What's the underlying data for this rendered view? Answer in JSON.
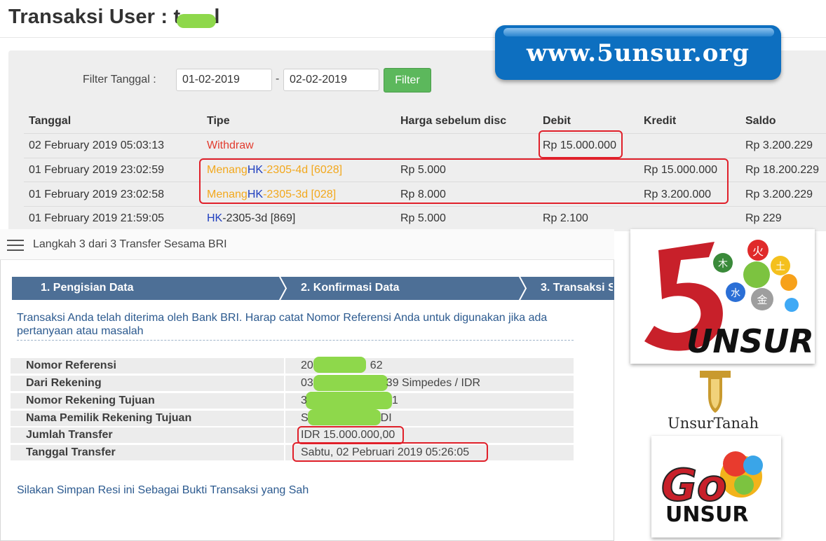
{
  "page": {
    "title": "Transaksi User : t",
    "title_tail": "l"
  },
  "filter": {
    "label": "Filter Tanggal :",
    "date_from": "01-02-2019",
    "separator": "-",
    "date_to": "02-02-2019",
    "button_label": "Filter"
  },
  "table": {
    "headers": [
      "Tanggal",
      "Tipe",
      "Harga sebelum disc",
      "Debit",
      "Kredit",
      "Saldo"
    ],
    "rows": [
      {
        "tanggal": "02 February 2019 05:03:13",
        "tipe_a": "Withdraw",
        "tipe_b": "",
        "tipe_c": "",
        "harga": "",
        "debit": "Rp 15.000.000",
        "kredit": "",
        "saldo": "Rp 3.200.229"
      },
      {
        "tanggal": "01 February 2019 23:02:59",
        "tipe_a": "Menang",
        "tipe_b": "HK",
        "tipe_c": "-2305-4d [6028]",
        "harga": "Rp 5.000",
        "debit": "",
        "kredit": "Rp 15.000.000",
        "saldo": "Rp 18.200.229"
      },
      {
        "tanggal": "01 February 2019 23:02:58",
        "tipe_a": "Menang",
        "tipe_b": "HK",
        "tipe_c": "-2305-3d [028]",
        "harga": "Rp 8.000",
        "debit": "",
        "kredit": "Rp 3.200.000",
        "saldo": "Rp 3.200.229"
      },
      {
        "tanggal": "01 February 2019 21:59:05",
        "tipe_a": "",
        "tipe_b": "HK",
        "tipe_c": "-2305-3d [869]",
        "harga": "Rp 5.000",
        "debit": "Rp 2.100",
        "kredit": "",
        "saldo": "Rp 229"
      }
    ]
  },
  "watermark": {
    "text": "www.5unsur.org"
  },
  "bri": {
    "step_title": "Langkah 3 dari 3 Transfer Sesama BRI",
    "steps": [
      "1. Pengisian Data",
      "2. Konfirmasi Data",
      "3. Transaksi S"
    ],
    "message": "Transaksi Anda telah diterima oleh Bank BRI. Harap catat Nomor Referensi Anda untuk digunakan jika ada pertanyaan atau masalah",
    "fields": [
      {
        "key": "Nomor Referensi",
        "value": "20",
        "value_tail": "62"
      },
      {
        "key": "Dari Rekening",
        "value": "03",
        "value_tail": "39 Simpedes / IDR"
      },
      {
        "key": "Nomor Rekening Tujuan",
        "value": "3",
        "value_tail": "1"
      },
      {
        "key": "Nama Pemilik Rekening Tujuan",
        "value": "S",
        "value_tail": "DI"
      },
      {
        "key": "Jumlah Transfer",
        "value": "IDR 15.000.000,00",
        "value_tail": ""
      },
      {
        "key": "Tanggal Transfer",
        "value": "Sabtu, 02 Pebruari 2019 05:26:05",
        "value_tail": ""
      }
    ],
    "footer": "Silakan Simpan Resi ini Sebagai Bukti Transaksi yang Sah"
  },
  "logos": {
    "logo1_text": "UNSUR",
    "logo1_kanji": [
      "火",
      "木",
      "土",
      "水",
      "金"
    ],
    "logo2_text": "UnsurTanah",
    "logo3_go": "Go",
    "logo3_text": "UNSUR"
  },
  "colors": {
    "red": "#e23b2e",
    "orange": "#f2a81d",
    "blue": "#1f3fbf",
    "highlight": "#e0202a",
    "filter_button": "#5cb85c",
    "bri_steps": "#4d6f96",
    "badge": "#0d6fc0"
  }
}
